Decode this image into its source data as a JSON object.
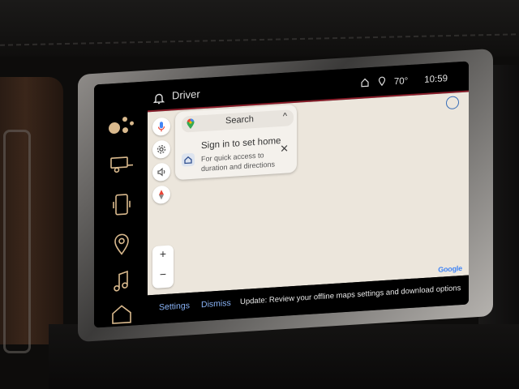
{
  "header": {
    "profile_label": "Driver"
  },
  "status_bar": {
    "temperature": "70°",
    "time": "10:59"
  },
  "search_card": {
    "search_label": "Search",
    "signin_title": "Sign in to set home",
    "signin_subtitle": "For quick access to duration and directions"
  },
  "map": {
    "attribution": "Google"
  },
  "bottom_bar": {
    "settings_label": "Settings",
    "dismiss_label": "Dismiss",
    "update_message": "Update: Review your offline maps settings and download options"
  },
  "icons": {
    "rail": [
      "assistant-icon",
      "trailer-icon",
      "phone-icon",
      "location-pin-icon",
      "music-note-icon",
      "home-icon"
    ],
    "map_controls": [
      "microphone-icon",
      "settings-gear-icon",
      "volume-icon",
      "compass-icon"
    ]
  },
  "colors": {
    "accent": "#d9b98d",
    "link": "#8ab4f8",
    "map_bg": "#ece6dc",
    "divider": "#8a1d2a"
  }
}
